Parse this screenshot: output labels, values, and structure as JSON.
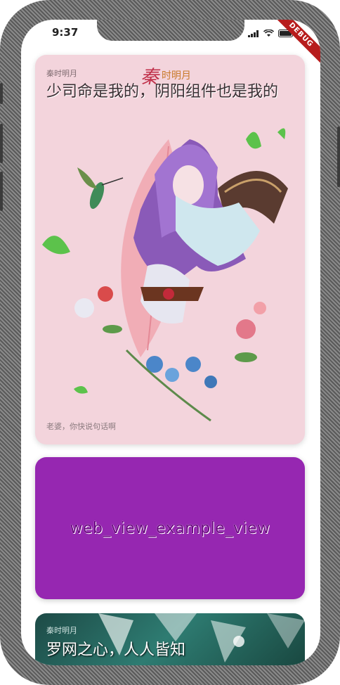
{
  "status_bar": {
    "time": "9:37",
    "debug_label": "DEBUG"
  },
  "cards": [
    {
      "subtitle": "秦时明月",
      "title": "少司命是我的，阴阳组件也是我的",
      "footer": "老婆，你快说句话啊"
    },
    {
      "label": "web_view_example_view",
      "color": "#9627b1"
    },
    {
      "subtitle": "秦时明月",
      "title": "罗网之心，人人皆知"
    }
  ]
}
